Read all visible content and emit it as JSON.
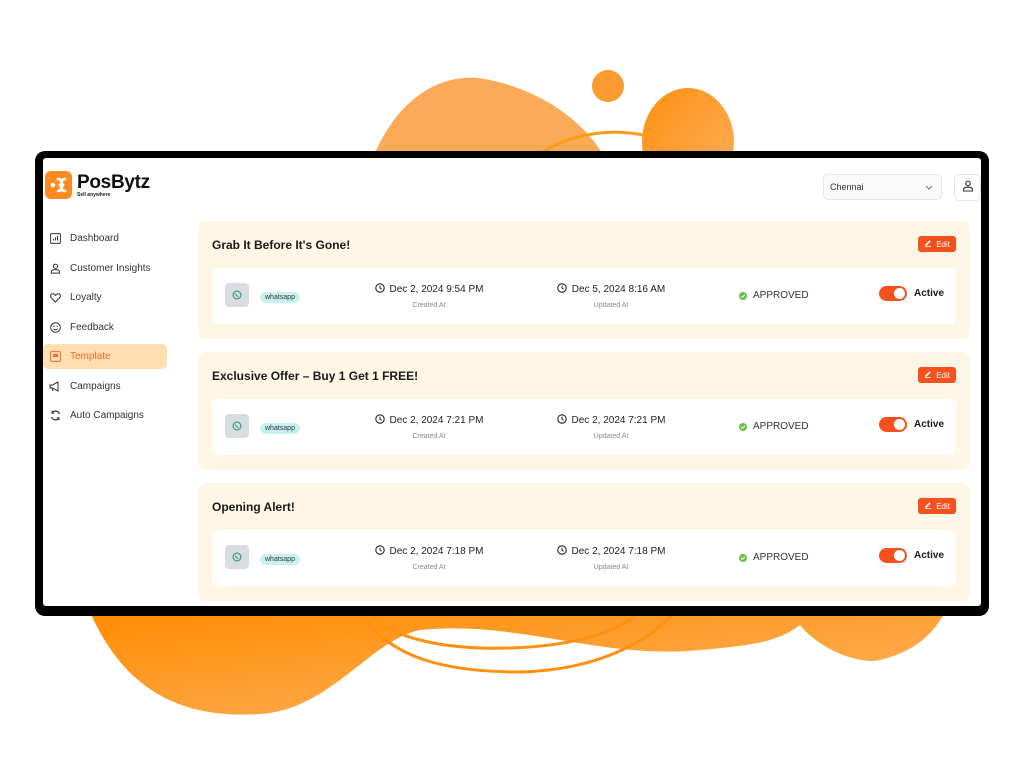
{
  "header": {
    "brand_name": "PosBytz",
    "brand_tagline": "Sell anywhere",
    "location_select": {
      "value": "Chennai",
      "icon": "chevron-down-icon"
    },
    "user_button": {
      "icon": "user-icon"
    }
  },
  "sidebar": {
    "items": [
      {
        "label": "Dashboard",
        "icon": "dashboard-icon",
        "active": false
      },
      {
        "label": "Customer Insights",
        "icon": "user-icon",
        "active": false
      },
      {
        "label": "Loyalty",
        "icon": "heart-icon",
        "active": false
      },
      {
        "label": "Feedback",
        "icon": "smiley-icon",
        "active": false
      },
      {
        "label": "Template",
        "icon": "template-icon",
        "active": true
      },
      {
        "label": "Campaigns",
        "icon": "megaphone-icon",
        "active": false
      },
      {
        "label": "Auto Campaigns",
        "icon": "refresh-icon",
        "active": false
      }
    ]
  },
  "templates": [
    {
      "title": "Grab It Before It's Gone!",
      "edit_label": "Edit",
      "channel": "whatsapp",
      "created": "Dec 2, 2024 9:54 PM",
      "created_label": "Created At",
      "updated": "Dec 5, 2024 8:16 AM",
      "updated_label": "Updated At",
      "status": "APPROVED",
      "active_label": "Active",
      "active": true
    },
    {
      "title": "Exclusive Offer – Buy 1 Get 1 FREE!",
      "edit_label": "Edit",
      "channel": "whatsapp",
      "created": "Dec 2, 2024 7:21 PM",
      "created_label": "Created At",
      "updated": "Dec 2, 2024 7:21 PM",
      "updated_label": "Updated At",
      "status": "APPROVED",
      "active_label": "Active",
      "active": true
    },
    {
      "title": "Opening Alert!",
      "edit_label": "Edit",
      "channel": "whatsapp",
      "created": "Dec 2, 2024 7:18 PM",
      "created_label": "Created At",
      "updated": "Dec 2, 2024 7:18 PM",
      "updated_label": "Updated At",
      "status": "APPROVED",
      "active_label": "Active",
      "active": true
    }
  ],
  "colors": {
    "brand_orange": "#ff8a1f",
    "accent_red_orange": "#f4511e",
    "card_bg": "#fff6e6",
    "active_nav_bg": "#ffdfb2",
    "approved_green": "#6cc04a",
    "channel_badge_bg": "#c7f2f0"
  }
}
